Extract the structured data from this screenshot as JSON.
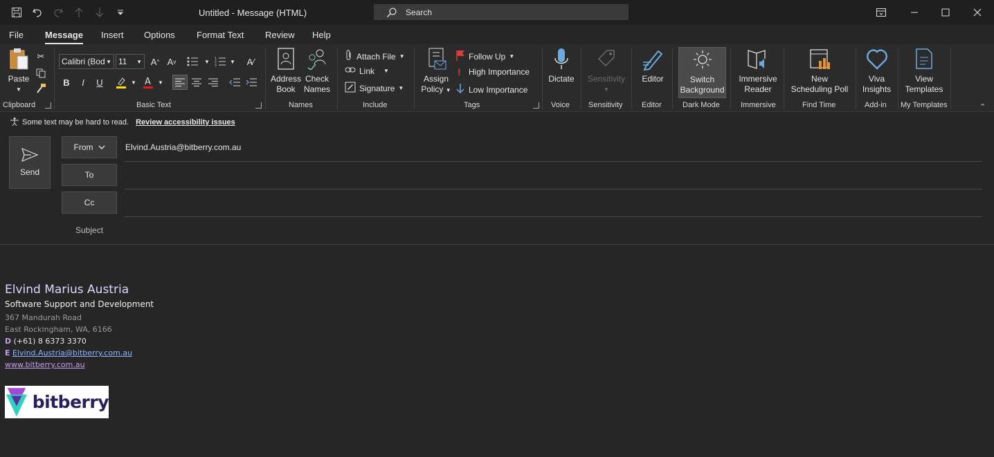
{
  "window": {
    "title": "Untitled  -  Message (HTML)",
    "search_placeholder": "Search"
  },
  "tabs": [
    "File",
    "Message",
    "Insert",
    "Options",
    "Format Text",
    "Review",
    "Help"
  ],
  "active_tab": "Message",
  "ribbon": {
    "clipboard": {
      "paste": "Paste",
      "label": "Clipboard"
    },
    "basic_text": {
      "font": "Calibri (Bod",
      "size": "11",
      "label": "Basic Text"
    },
    "names": {
      "address_book_1": "Address",
      "address_book_2": "Book",
      "check_names_1": "Check",
      "check_names_2": "Names",
      "label": "Names"
    },
    "include": {
      "attach": "Attach File",
      "link": "Link",
      "signature": "Signature",
      "label": "Include"
    },
    "tags": {
      "assign_1": "Assign",
      "assign_2": "Policy",
      "follow_up": "Follow Up",
      "high": "High Importance",
      "low": "Low Importance",
      "label": "Tags"
    },
    "voice": {
      "dictate": "Dictate",
      "label": "Voice"
    },
    "sensitivity": {
      "btn": "Sensitivity",
      "label": "Sensitivity"
    },
    "editor": {
      "btn": "Editor",
      "label": "Editor"
    },
    "dark_mode": {
      "btn_1": "Switch",
      "btn_2": "Background",
      "label": "Dark Mode"
    },
    "immersive": {
      "btn_1": "Immersive",
      "btn_2": "Reader",
      "label": "Immersive"
    },
    "find_time": {
      "btn_1": "New",
      "btn_2": "Scheduling Poll",
      "label": "Find Time"
    },
    "addin": {
      "btn_1": "Viva",
      "btn_2": "Insights",
      "label": "Add-in"
    },
    "templates": {
      "btn_1": "View",
      "btn_2": "Templates",
      "label": "My Templates"
    }
  },
  "notice": {
    "text": "Some text may be hard to read.",
    "link": "Review accessibility issues"
  },
  "compose": {
    "send": "Send",
    "from_label": "From",
    "from_value": "Elvind.Austria@bitberry.com.au",
    "to_label": "To",
    "cc_label": "Cc",
    "subject_label": "Subject"
  },
  "signature": {
    "name": "Elvind Marius Austria",
    "title": "Software Support and Development",
    "address1": "367 Mandurah Road",
    "address2": "East Rockingham, WA, 6166",
    "phone_key": "D",
    "phone": "(+61) 8 6373 3370",
    "email_key": "E",
    "email": "Elvind.Austria@bitberry.com.au",
    "website": "www.bitberry.com.au",
    "logo_text": "bitberry"
  },
  "colors": {
    "accent_purple": "#c89cf5",
    "link_blue": "#8fb4ff",
    "flag_red": "#e03a3a"
  }
}
